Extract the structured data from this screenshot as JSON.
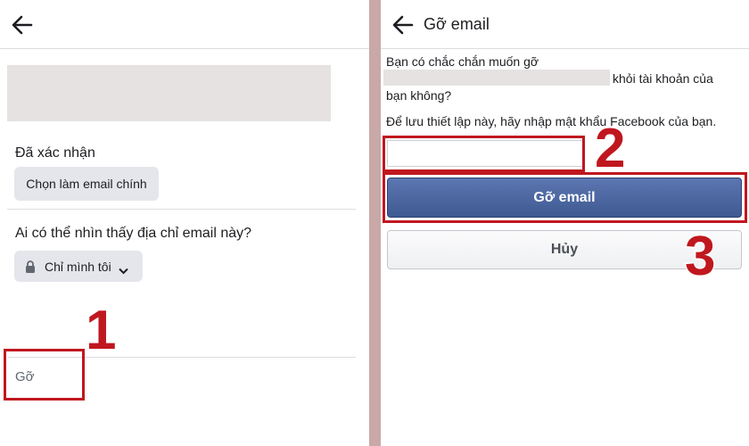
{
  "left": {
    "status_label": "Đã xác nhận",
    "make_primary_button": "Chọn làm email chính",
    "visibility_question": "Ai có thể nhìn thấy địa chỉ email này?",
    "audience_selector": "Chỉ mình tôi",
    "remove_link": "Gỡ",
    "step_number": "1"
  },
  "right": {
    "title": "Gỡ email",
    "confirm_text_line1": "Bạn có chắc chắn muốn gỡ",
    "confirm_text_line2_end": "khỏi tài khoản của",
    "confirm_text_line3": "bạn không?",
    "password_prompt": "Để lưu thiết lập này, hãy nhập mật khẩu Facebook của bạn.",
    "password_value": "",
    "remove_email_button": "Gỡ email",
    "cancel_button": "Hủy",
    "step_number_2": "2",
    "step_number_3": "3"
  },
  "colors": {
    "highlight_red": "#c0171f",
    "facebook_blue": "#4a66a0",
    "page_gutter": "#c9a8a8"
  },
  "icons": [
    "back-arrow-icon",
    "lock-icon",
    "caret-down-icon"
  ]
}
